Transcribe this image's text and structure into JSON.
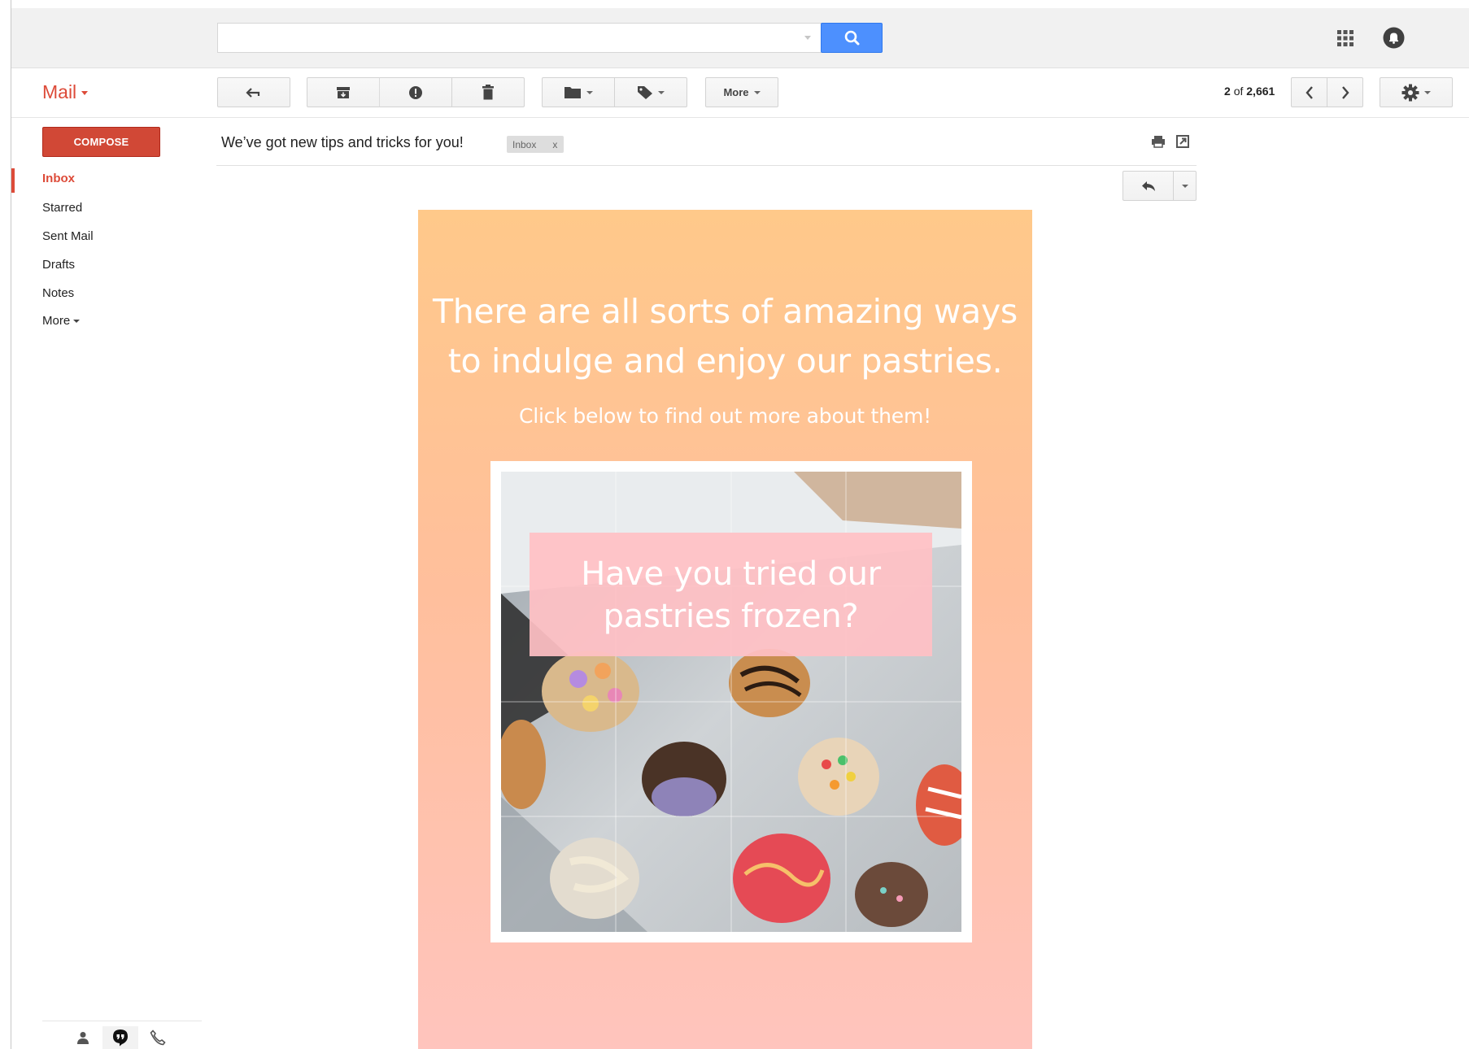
{
  "search": {
    "value": "",
    "placeholder": ""
  },
  "app": {
    "title": "Mail"
  },
  "toolbar": {
    "back_icon": "back-arrow-icon",
    "archive_icon": "archive-icon",
    "spam_icon": "report-spam-icon",
    "delete_icon": "trash-icon",
    "move_icon": "folder-icon",
    "labels_icon": "label-tag-icon",
    "more_label": "More",
    "pager": {
      "current": "2",
      "of_label": "of",
      "total": "2,661"
    }
  },
  "sidebar": {
    "compose_label": "COMPOSE",
    "items": [
      {
        "label": "Inbox",
        "active": true
      },
      {
        "label": "Starred"
      },
      {
        "label": "Sent Mail"
      },
      {
        "label": "Drafts"
      },
      {
        "label": "Notes"
      },
      {
        "label": "More"
      }
    ],
    "footer_icons": [
      "person-icon",
      "hangouts-icon",
      "phone-icon"
    ]
  },
  "message": {
    "subject": "We’ve got new tips and tricks for you!",
    "label_chip": "Inbox",
    "label_chip_close": "x"
  },
  "email": {
    "headline_line1": "There are all sorts of amazing ways",
    "headline_line2": "to indulge and enjoy our pastries.",
    "subline": "Click below to find out more about them!",
    "overlay_line1": "Have you tried our",
    "overlay_line2": "pastries frozen?"
  },
  "colors": {
    "accent_red": "#dd4b39",
    "compose_red": "#d14836",
    "search_blue": "#4d90fe",
    "email_top": "#ffc98a",
    "email_bottom": "#ffc4bd"
  }
}
